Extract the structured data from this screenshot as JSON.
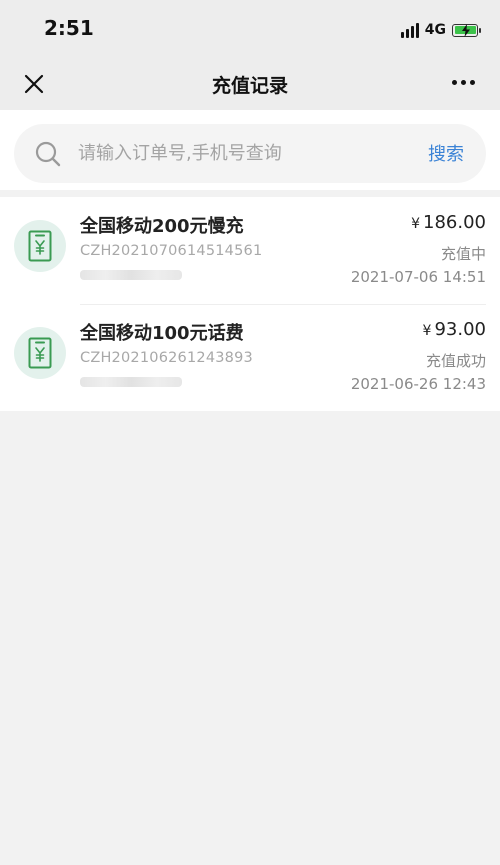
{
  "status_bar": {
    "time": "2:51",
    "network": "4G"
  },
  "nav": {
    "title": "充值记录"
  },
  "search": {
    "placeholder": "请输入订单号,手机号查询",
    "button_label": "搜索"
  },
  "records": [
    {
      "title": "全国移动200元慢充",
      "order_no": "CZH2021070614514561",
      "currency": "¥",
      "amount": "186.00",
      "status": "充值中",
      "time": "2021-07-06 14:51"
    },
    {
      "title": "全国移动100元话费",
      "order_no": "CZH202106261243893",
      "currency": "¥",
      "amount": "93.00",
      "status": "充值成功",
      "time": "2021-06-26 12:43"
    }
  ],
  "colors": {
    "accent": "#3b83d6",
    "icon_green": "#3a9a52",
    "icon_bg": "#e3f1ec"
  }
}
